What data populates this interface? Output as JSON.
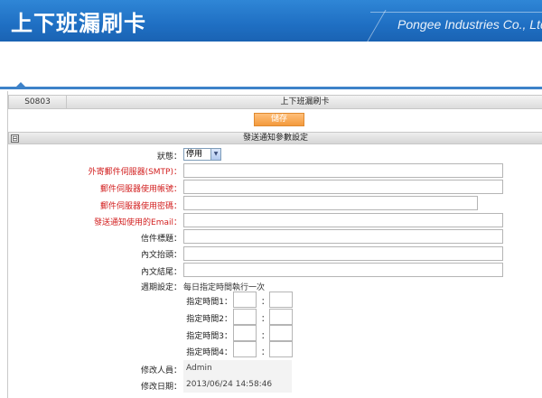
{
  "header": {
    "title": "上下班漏刷卡",
    "company": "Pongee Industries Co., Ltd."
  },
  "panel": {
    "code": "S0803",
    "title": "上下班漏刷卡",
    "save_label": "儲存",
    "section_title": "發送通知參數設定",
    "toggle": "⊟"
  },
  "form": {
    "status_label": "狀態：",
    "status_value": "停用",
    "smtp_label": "外寄郵件伺服器(SMTP)：",
    "account_label": "郵件伺服器使用帳號：",
    "password_label": "郵件伺服器使用密碼：",
    "email_label": "發送通知使用的Email：",
    "subject_label": "信件標題：",
    "header_label": "內文抬頭：",
    "footer_label": "內文結尾：",
    "cycle_label": "週期設定：",
    "cycle_value": "每日指定時間執行一次",
    "time_labels": [
      "指定時間1：",
      "指定時間2：",
      "指定時間3：",
      "指定時間4："
    ],
    "colon": "：",
    "modifier_label": "修改人員：",
    "modifier_value": "Admin",
    "modified_label": "修改日期：",
    "modified_value": "2013/06/24 14:58:46"
  }
}
